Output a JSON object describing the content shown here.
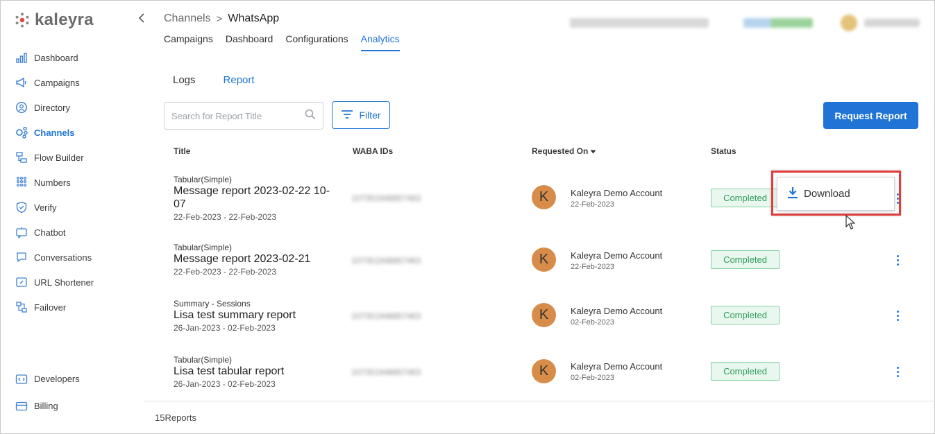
{
  "brand": {
    "name": "kaleyra"
  },
  "sidebar": {
    "items": [
      {
        "label": "Dashboard",
        "icon": "bar-chart-icon",
        "active": false
      },
      {
        "label": "Campaigns",
        "icon": "megaphone-icon",
        "active": false
      },
      {
        "label": "Directory",
        "icon": "contact-icon",
        "active": false
      },
      {
        "label": "Channels",
        "icon": "channels-icon",
        "active": true
      },
      {
        "label": "Flow Builder",
        "icon": "flow-icon",
        "active": false
      },
      {
        "label": "Numbers",
        "icon": "dialpad-icon",
        "active": false
      },
      {
        "label": "Verify",
        "icon": "shield-icon",
        "active": false
      },
      {
        "label": "Chatbot",
        "icon": "chatbot-icon",
        "active": false
      },
      {
        "label": "Conversations",
        "icon": "chat-bubble-icon",
        "active": false
      },
      {
        "label": "URL Shortener",
        "icon": "link-icon",
        "active": false
      },
      {
        "label": "Failover",
        "icon": "failover-icon",
        "active": false
      }
    ],
    "bottom_items": [
      {
        "label": "Developers",
        "icon": "code-icon"
      },
      {
        "label": "Billing",
        "icon": "card-icon"
      }
    ]
  },
  "header": {
    "breadcrumb_parent": "Channels",
    "breadcrumb_sep": ">",
    "breadcrumb_current": "WhatsApp",
    "tabs": [
      "Campaigns",
      "Dashboard",
      "Configurations",
      "Analytics"
    ],
    "active_tab": "Analytics"
  },
  "sub_tabs": [
    "Logs",
    "Report"
  ],
  "active_sub_tab": "Report",
  "toolbar": {
    "search_placeholder": "Search for Report Title",
    "filter_label": "Filter",
    "request_label": "Request Report"
  },
  "table": {
    "headers": {
      "title": "Title",
      "waba": "WABA IDs",
      "requested_on": "Requested On",
      "status": "Status"
    },
    "rows": [
      {
        "type": "Tabular(Simple)",
        "name": "Message report 2023-02-22 10-07",
        "range": "22-Feb-2023 - 22-Feb-2023",
        "waba": "107351948857463",
        "initial": "K",
        "requester": "Kaleyra Demo Account",
        "req_date": "22-Feb-2023",
        "status": "Completed"
      },
      {
        "type": "Tabular(Simple)",
        "name": "Message report 2023-02-21",
        "range": "22-Feb-2023 - 22-Feb-2023",
        "waba": "107351948857463",
        "initial": "K",
        "requester": "Kaleyra Demo Account",
        "req_date": "22-Feb-2023",
        "status": "Completed"
      },
      {
        "type": "Summary - Sessions",
        "name": "Lisa test summary report",
        "range": "26-Jan-2023 - 02-Feb-2023",
        "waba": "107351948857463",
        "initial": "K",
        "requester": "Kaleyra Demo Account",
        "req_date": "02-Feb-2023",
        "status": "Completed"
      },
      {
        "type": "Tabular(Simple)",
        "name": "Lisa test tabular report",
        "range": "26-Jan-2023 - 02-Feb-2023",
        "waba": "107351948857463",
        "initial": "K",
        "requester": "Kaleyra Demo Account",
        "req_date": "02-Feb-2023",
        "status": "Completed"
      }
    ]
  },
  "footer": {
    "count": "15Reports"
  },
  "dropdown": {
    "download_label": "Download"
  },
  "colors": {
    "accent": "#1f74d6",
    "status_green": "#2e9a5a",
    "highlight": "#e23b3b",
    "avatar": "#d88c4a"
  }
}
